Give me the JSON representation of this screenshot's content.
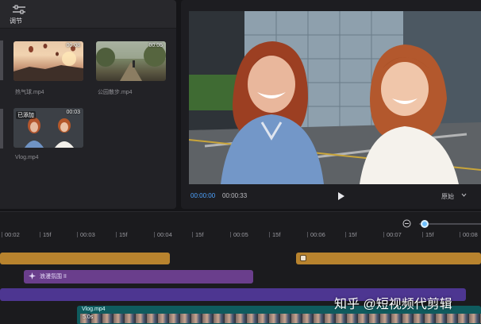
{
  "media": {
    "adjust_tab_label": "调节",
    "clips": [
      {
        "name": "热气球.mp4",
        "duration": "00:08",
        "added_badge": ""
      },
      {
        "name": "公园散步.mp4",
        "duration": "00:05",
        "added_badge": ""
      },
      {
        "name": "Vlog.mp4",
        "duration": "00:03",
        "added_badge": "已添加"
      }
    ]
  },
  "player": {
    "current_time": "00:00:00",
    "total_time": "00:00:33",
    "ratio_label": "原始"
  },
  "timeline": {
    "ruler_ticks": [
      "00:02",
      "15f",
      "00:03",
      "15f",
      "00:04",
      "15f",
      "00:05",
      "15f",
      "00:06",
      "15f",
      "00:07",
      "15f",
      "00:08"
    ],
    "effect_label": "浪漫氛围 II",
    "main_clip_label": "Vlog.mp4",
    "filmstrip_label": "5.0s"
  },
  "colors": {
    "accent": "#4ea3ff",
    "audio_track": "#b8832e",
    "effect_track": "#6a3e8c",
    "filter_track": "#4d3691",
    "main_track": "#0f5b5e"
  },
  "watermark": "知乎 @短视频代剪辑"
}
